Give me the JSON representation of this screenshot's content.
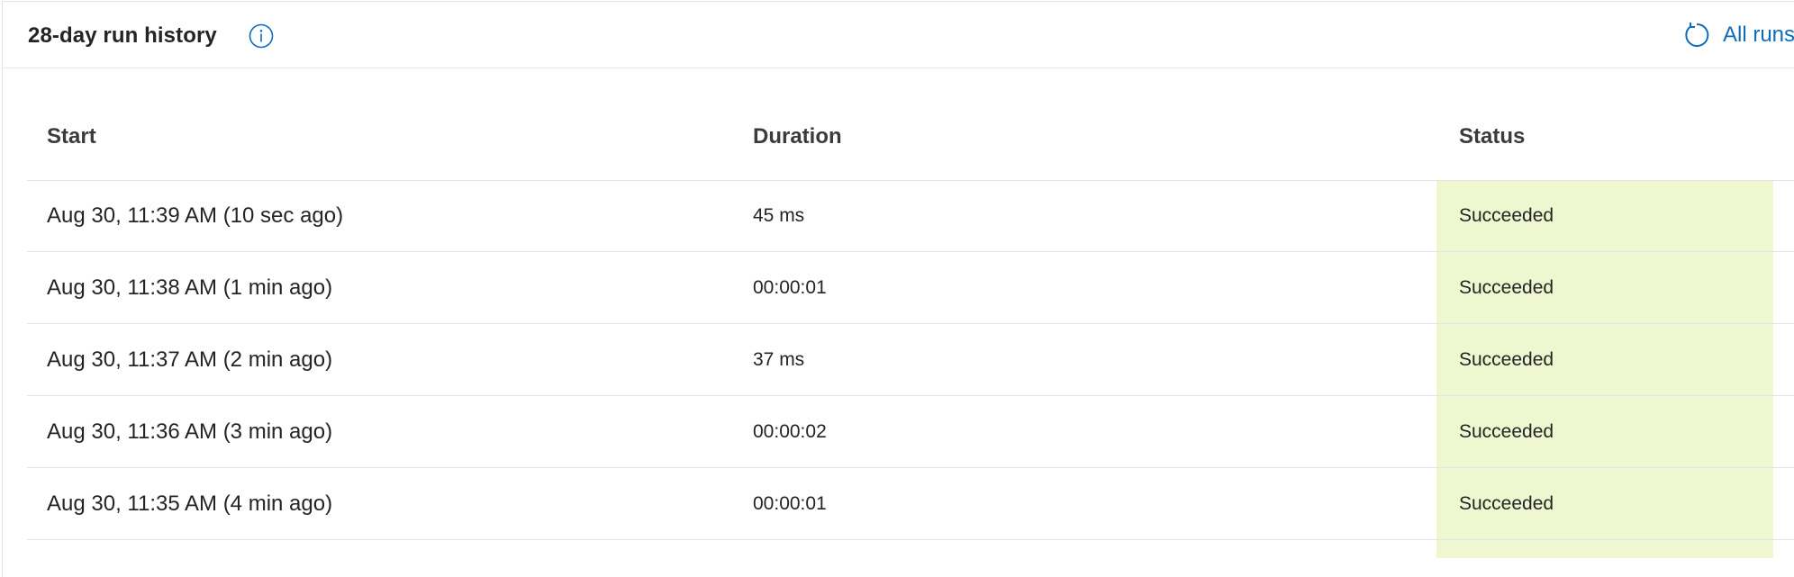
{
  "panel": {
    "title": "28-day run history",
    "info_icon": "info-icon",
    "all_runs_label": "All runs",
    "refresh_icon": "refresh-icon"
  },
  "table": {
    "columns": [
      "Start",
      "Duration",
      "Status"
    ],
    "rows": [
      {
        "start": "Aug 30, 11:39 AM (10 sec ago)",
        "duration": "45 ms",
        "status": "Succeeded"
      },
      {
        "start": "Aug 30, 11:38 AM (1 min ago)",
        "duration": "00:00:01",
        "status": "Succeeded"
      },
      {
        "start": "Aug 30, 11:37 AM (2 min ago)",
        "duration": "37 ms",
        "status": "Succeeded"
      },
      {
        "start": "Aug 30, 11:36 AM (3 min ago)",
        "duration": "00:00:02",
        "status": "Succeeded"
      },
      {
        "start": "Aug 30, 11:35 AM (4 min ago)",
        "duration": "00:00:01",
        "status": "Succeeded"
      }
    ]
  },
  "colors": {
    "accent": "#0f6cbd",
    "succeeded_bg": "#eff7d0"
  }
}
